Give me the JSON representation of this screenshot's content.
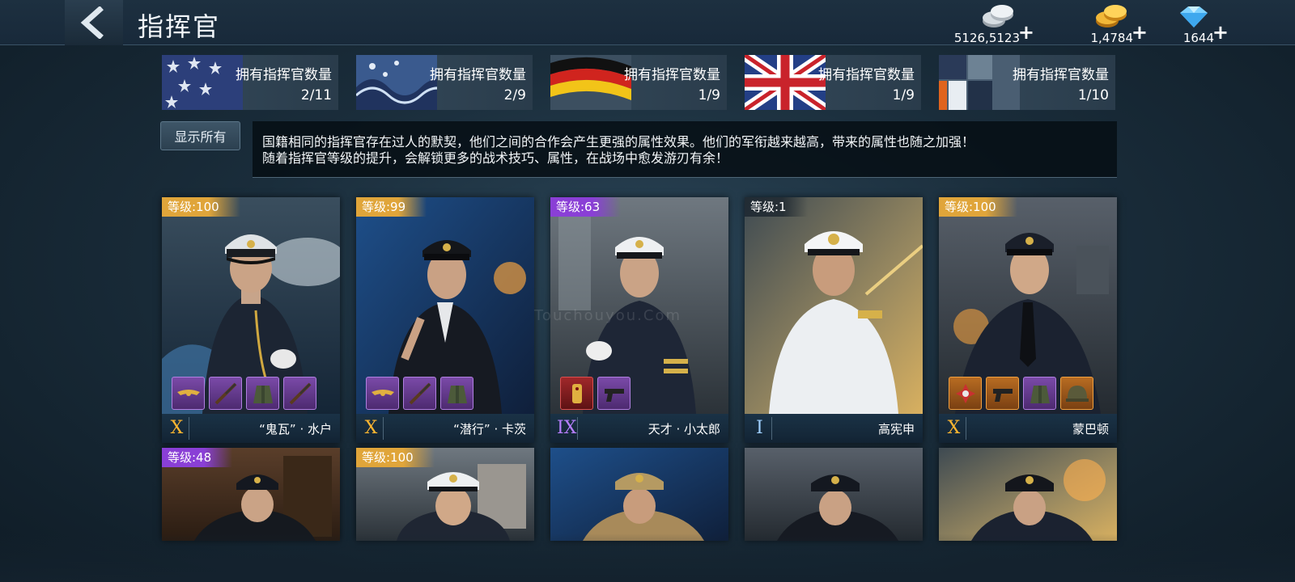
{
  "header": {
    "title": "指挥官",
    "currencies": [
      {
        "icon": "silver-coins-icon",
        "value": "5126,5123"
      },
      {
        "icon": "gold-coins-icon",
        "value": "1,4784"
      },
      {
        "icon": "diamond-icon",
        "value": "1644"
      }
    ],
    "plus": "+"
  },
  "factions": [
    {
      "flag": "usa",
      "label": "拥有指挥官数量",
      "count": "2/11"
    },
    {
      "flag": "japan",
      "label": "拥有指挥官数量",
      "count": "2/9"
    },
    {
      "flag": "germany",
      "label": "拥有指挥官数量",
      "count": "1/9"
    },
    {
      "flag": "uk",
      "label": "拥有指挥官数量",
      "count": "1/9"
    },
    {
      "flag": "soviet",
      "label": "拥有指挥官数量",
      "count": "1/10"
    }
  ],
  "show_all_label": "显示所有",
  "info": {
    "line1": "国籍相同的指挥官存在过人的默契，他们之间的合作会产生更强的属性效果。他们的军衔越来越高，带来的属性也随之加强！",
    "line2": "随着指挥官等级的提升，会解锁更多的战术技巧、属性，在战场中愈发游刃有余！"
  },
  "watermark": "Touchouyou.Com",
  "commanders": [
    {
      "level": "等级:100",
      "level_color": "gold",
      "rank": "X",
      "rank_color": "gold",
      "name": "“鬼瓦” · 水户",
      "items": [
        "eagle-badge-icon",
        "rifle-icon",
        "uniform-icon",
        "rifle-icon"
      ]
    },
    {
      "level": "等级:99",
      "level_color": "gold",
      "rank": "X",
      "rank_color": "gold",
      "name": "“潜行” · 卡茨",
      "items": [
        "eagle-badge-icon",
        "rifle-icon",
        "uniform-icon"
      ]
    },
    {
      "level": "等级:63",
      "level_color": "purple",
      "rank": "IX",
      "rank_color": "purple",
      "name": "天才 · 小太郎",
      "items": [
        "shoulder-board-icon",
        "pistol-icon"
      ]
    },
    {
      "level": "等级:1",
      "level_color": "none",
      "rank": "I",
      "rank_color": "blue",
      "name": "高宪申",
      "items": []
    },
    {
      "level": "等级:100",
      "level_color": "gold",
      "rank": "X",
      "rank_color": "gold",
      "name": "蒙巴顿",
      "items": [
        "medal-cross-icon",
        "pistol-icon",
        "uniform-icon",
        "helmet-icon"
      ]
    },
    {
      "level": "等级:48",
      "level_color": "purple"
    },
    {
      "level": "等级:100",
      "level_color": "gold"
    },
    {
      "level": "",
      "level_color": "hidden"
    },
    {
      "level": "",
      "level_color": "hidden"
    },
    {
      "level": "",
      "level_color": "hidden"
    }
  ]
}
